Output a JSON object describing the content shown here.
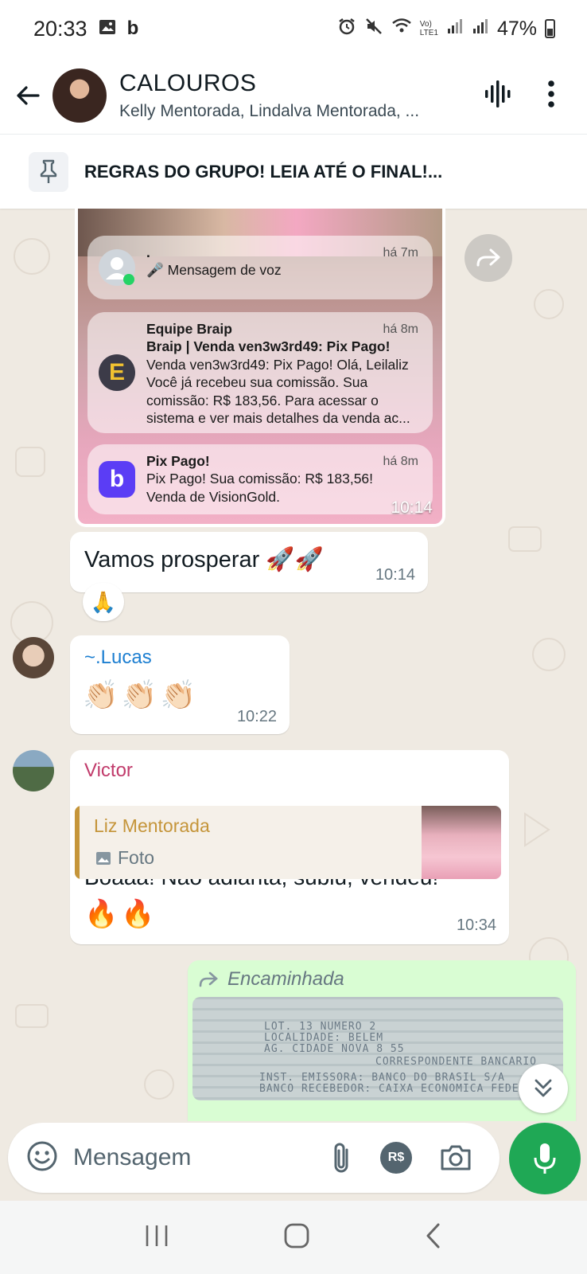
{
  "status_bar": {
    "time": "20:33",
    "b_indicator": "b",
    "lte_top": "Vo)",
    "lte_bottom": "LTE1",
    "battery": "47%"
  },
  "header": {
    "title": "CALOUROS",
    "subtitle": "Kelly Mentorada, Lindalva Mentorada, ..."
  },
  "pinned": {
    "text": "REGRAS DO GRUPO! LEIA ATÉ O FINAL!..."
  },
  "messages": {
    "image_message": {
      "time": "10:14",
      "notifications": [
        {
          "title": ".",
          "time": "há 7m",
          "body": "🎤 Mensagem de voz"
        },
        {
          "title": "Equipe Braip",
          "time": "há 8m",
          "subtitle": "Braip | Venda ven3w3rd49: Pix Pago!",
          "body_line1": "Venda ven3w3rd49: Pix Pago! Olá, Leilaliz",
          "body_line2": "Você já recebeu sua comissão. Sua",
          "body_line3": "comissão: R$ 183,56. Para acessar o",
          "body_line4": "sistema e ver mais detalhes da venda ac...",
          "icon_letter": "E"
        },
        {
          "title": "Pix Pago!",
          "time": "há 8m",
          "body_line1": "Pix Pago! Sua comissão: R$ 183,56!",
          "body_line2": "Venda de VisionGold.",
          "icon_letter": "b"
        }
      ]
    },
    "text_message_1": {
      "text": "Vamos prosperar 🚀🚀",
      "time": "10:14",
      "reaction": "🙏"
    },
    "lucas_message": {
      "sender": "~.Lucas",
      "emojis": "👏🏻👏🏻👏🏻",
      "time": "10:22"
    },
    "victor_message": {
      "sender": "Victor",
      "quote_name": "Liz Mentorada",
      "quote_type": "Foto",
      "text": "Boaaa! Não adianta, subiu, vendeu!",
      "emojis": "🔥🔥",
      "time": "10:34"
    },
    "forwarded_message": {
      "label": "Encaminhada",
      "receipt_lines": [
        "LOT. 13 NUMERO 2",
        "LOCALIDADE: BELEM",
        "AG. CIDADE NOVA 8 55",
        "CORRESPONDENTE BANCARIO",
        "INST. EMISSORA: BANCO DO BRASIL S/A",
        "BANCO RECEBEDOR: CAIXA ECONOMICA FEDERAL"
      ]
    }
  },
  "composer": {
    "placeholder": "Mensagem",
    "currency_label": "R$"
  },
  "colors": {
    "accent_green": "#1fa855",
    "outgoing_bubble": "#d9fdd3",
    "victor_name": "#c13b6b",
    "lucas_name": "#1d7fd1",
    "quote_name": "#c5953a"
  }
}
